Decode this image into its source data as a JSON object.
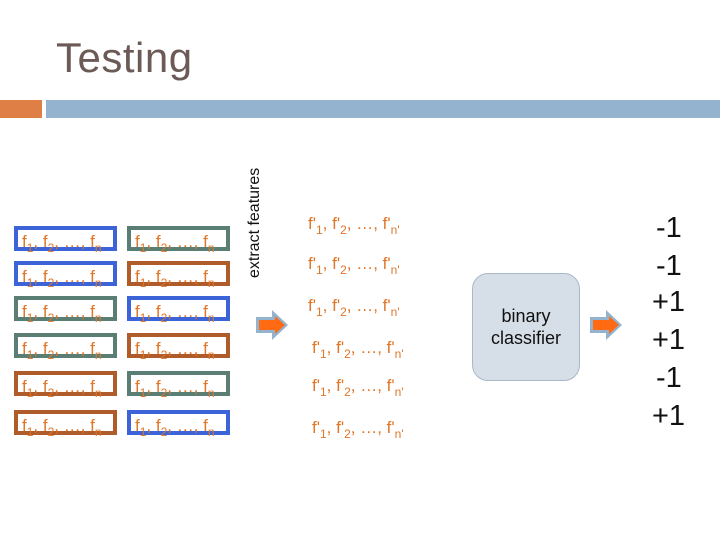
{
  "title": "Testing",
  "feature_text": {
    "f": "f",
    "sub1": "1",
    "sep1": ", ",
    "sub2": "2",
    "ellipsis": ", …, ",
    "subn": "n"
  },
  "feature_grid": {
    "rows": [
      {
        "left_border": "blue",
        "right_border": "green"
      },
      {
        "left_border": "blue",
        "right_border": "brown"
      },
      {
        "left_border": "green",
        "right_border": "blue"
      },
      {
        "left_border": "green",
        "right_border": "brown"
      },
      {
        "left_border": "brown",
        "right_border": "green"
      },
      {
        "left_border": "brown",
        "right_border": "blue"
      }
    ]
  },
  "colors": {
    "blue": "#3d63d8",
    "green": "#5b7e74",
    "brown": "#b05c2a",
    "feature_text": "#e07628",
    "arrow_fill": "#ff6a13",
    "arrow_outline": "#93b3cf"
  },
  "extract_label": "extract features",
  "extracted_features": {
    "f": "f'",
    "sub1": "1",
    "sub2": "2",
    "subn": "n'",
    "count": 6
  },
  "classifier": {
    "line1": "binary",
    "line2": "classifier"
  },
  "outputs": [
    "-1",
    "-1",
    "+1",
    "+1",
    "-1",
    "+1"
  ],
  "icons": {
    "arrow": "right-arrow-icon"
  }
}
